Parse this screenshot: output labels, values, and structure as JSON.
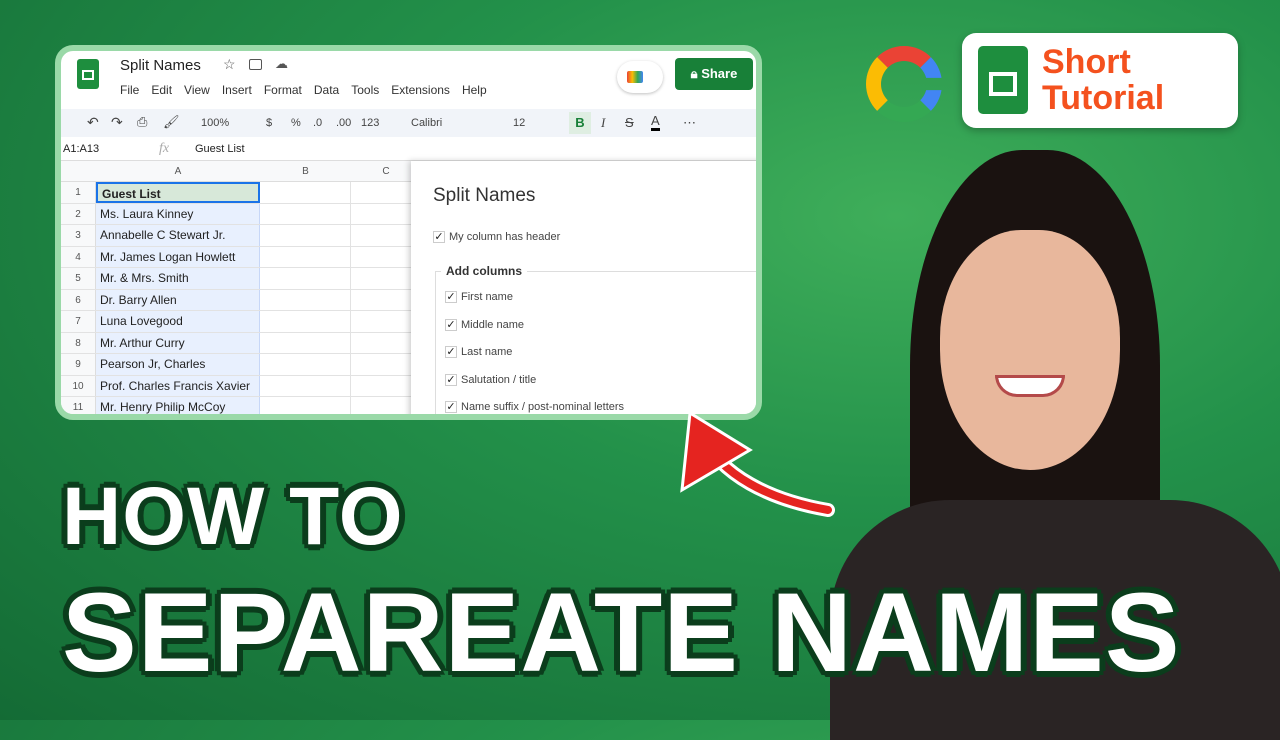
{
  "sheets": {
    "doc_title": "Split Names",
    "menu": [
      "File",
      "Edit",
      "View",
      "Insert",
      "Format",
      "Data",
      "Tools",
      "Extensions",
      "Help"
    ],
    "share_label": "Share",
    "zoom": "100%",
    "currency": "$",
    "percent": "%",
    "dec_less": ".0",
    "dec_more": ".00",
    "number_format": "123",
    "font": "Calibri",
    "font_size": "12",
    "bold": "B",
    "italic": "I",
    "strike": "S",
    "text_color": "A",
    "more": "⋯",
    "name_box": "A1:A13",
    "fx": "fx",
    "formula": "Guest List",
    "columns": [
      "A",
      "B",
      "C"
    ],
    "rows": [
      {
        "n": "1",
        "a": "Guest List"
      },
      {
        "n": "2",
        "a": "Ms. Laura Kinney"
      },
      {
        "n": "3",
        "a": "Annabelle C Stewart Jr."
      },
      {
        "n": "4",
        "a": "Mr. James Logan Howlett"
      },
      {
        "n": "5",
        "a": "Mr. & Mrs. Smith"
      },
      {
        "n": "6",
        "a": "Dr. Barry Allen"
      },
      {
        "n": "7",
        "a": "Luna Lovegood"
      },
      {
        "n": "8",
        "a": "Mr. Arthur Curry"
      },
      {
        "n": "9",
        "a": "Pearson Jr, Charles"
      },
      {
        "n": "10",
        "a": "Prof. Charles Francis Xavier"
      },
      {
        "n": "11",
        "a": "Mr. Henry Philip McCoy"
      }
    ],
    "dialog": {
      "title": "Split Names",
      "header_option": "My column has header",
      "section": "Add columns",
      "options": [
        "First name",
        "Middle name",
        "Last name",
        "Salutation / title",
        "Name suffix / post-nominal letters"
      ]
    }
  },
  "badge": {
    "line1": "Short",
    "line2": "Tutorial",
    "color": "#f4511e"
  },
  "headline": {
    "line1": "HOW TO",
    "line2": "SEPAREATE NAMES"
  },
  "colors": {
    "accent": "#188038",
    "background": "#23914a",
    "arrow": "#e52420"
  }
}
